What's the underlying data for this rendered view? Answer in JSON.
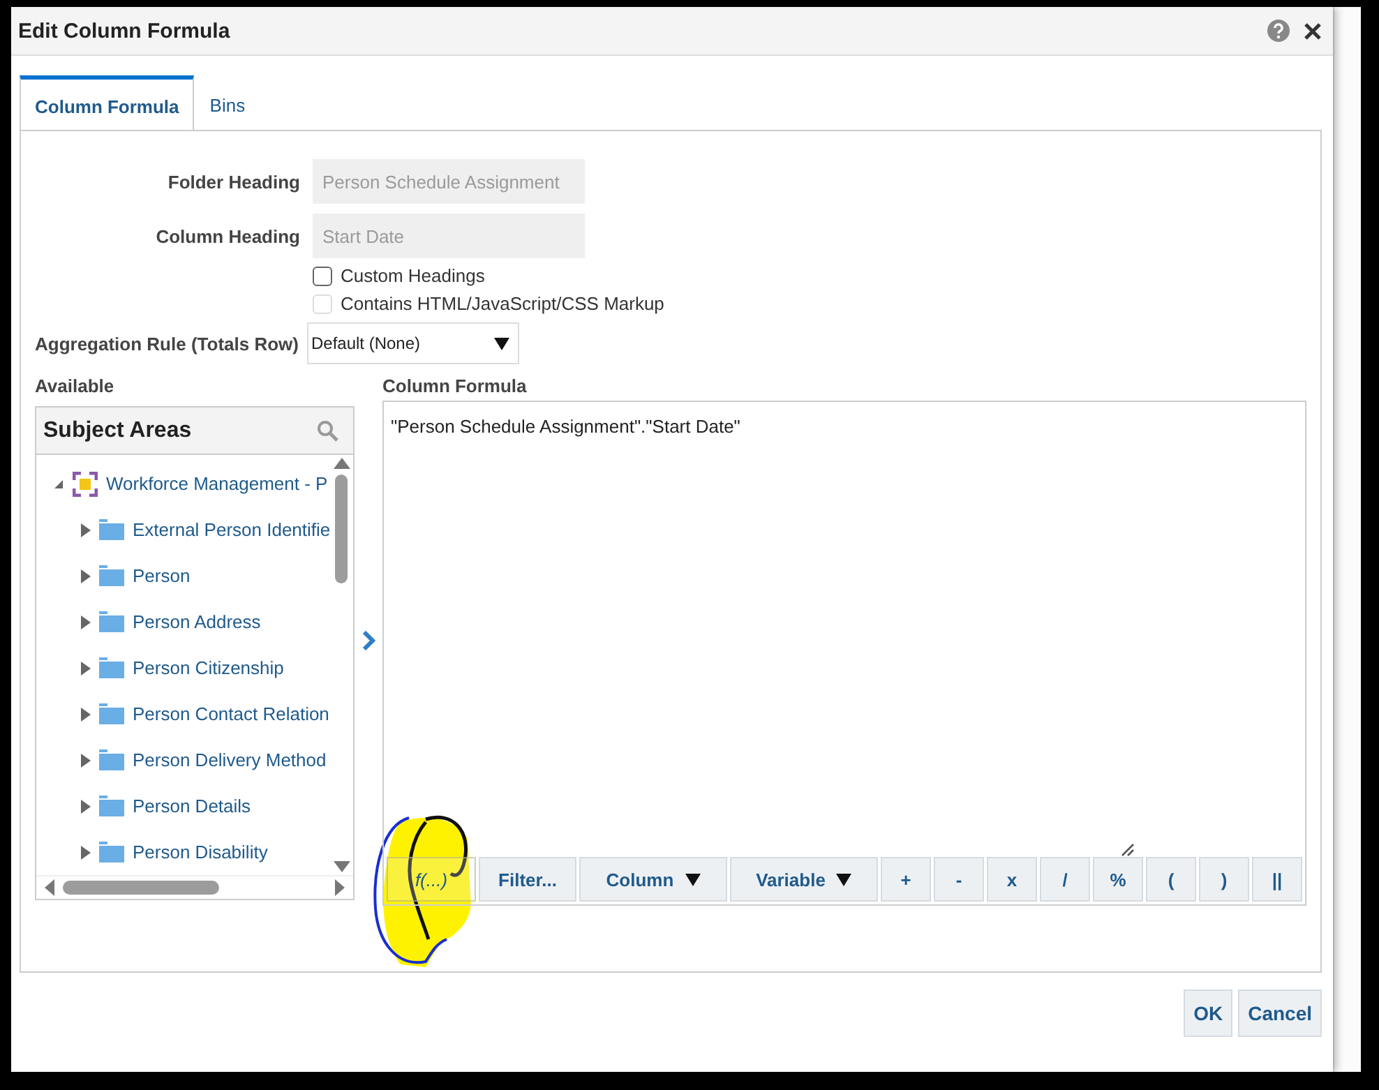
{
  "window": {
    "title": "Edit Column Formula"
  },
  "tabs": [
    {
      "label": "Column Formula",
      "selected": true
    },
    {
      "label": "Bins",
      "selected": false
    }
  ],
  "fields": [
    {
      "label": "Folder Heading",
      "value": "Person Schedule Assignment",
      "disabled": true
    },
    {
      "label": "Column Heading",
      "value": "Start Date",
      "disabled": true
    }
  ],
  "checkboxes": [
    {
      "label": "Custom Headings",
      "checked": false,
      "disabled": false
    },
    {
      "label": "Contains HTML/JavaScript/CSS Markup",
      "checked": false,
      "disabled": true
    }
  ],
  "aggregation": {
    "label": "Aggregation Rule (Totals Row)",
    "value": "Default (None)"
  },
  "available": {
    "label": "Available",
    "panel_title": "Subject Areas",
    "tree": [
      {
        "label": "Workforce Management - P",
        "kind": "subject_area",
        "expanded": true,
        "children": [
          {
            "label": "External Person Identifie",
            "kind": "folder",
            "expanded": false
          },
          {
            "label": "Person",
            "kind": "folder",
            "expanded": false
          },
          {
            "label": "Person Address",
            "kind": "folder",
            "expanded": false
          },
          {
            "label": "Person Citizenship",
            "kind": "folder",
            "expanded": false
          },
          {
            "label": "Person Contact Relation",
            "kind": "folder",
            "expanded": false
          },
          {
            "label": "Person Delivery Method",
            "kind": "folder",
            "expanded": false
          },
          {
            "label": "Person Details",
            "kind": "folder",
            "expanded": false
          },
          {
            "label": "Person Disability",
            "kind": "folder",
            "expanded": false
          }
        ]
      }
    ]
  },
  "formula": {
    "label": "Column Formula",
    "value": "\"Person Schedule Assignment\".\"Start Date\"",
    "toolbar": [
      {
        "label": "f(...)",
        "kind": "function"
      },
      {
        "label": "Filter...",
        "kind": "plain"
      },
      {
        "label": "Column",
        "kind": "menu"
      },
      {
        "label": "Variable",
        "kind": "menu"
      },
      {
        "label": "+",
        "kind": "operator"
      },
      {
        "label": "-",
        "kind": "operator"
      },
      {
        "label": "x",
        "kind": "operator"
      },
      {
        "label": "/",
        "kind": "operator"
      },
      {
        "label": "%",
        "kind": "operator"
      },
      {
        "label": "(",
        "kind": "operator"
      },
      {
        "label": ")",
        "kind": "operator"
      },
      {
        "label": "||",
        "kind": "operator"
      }
    ]
  },
  "buttons": [
    "OK",
    "Cancel"
  ]
}
